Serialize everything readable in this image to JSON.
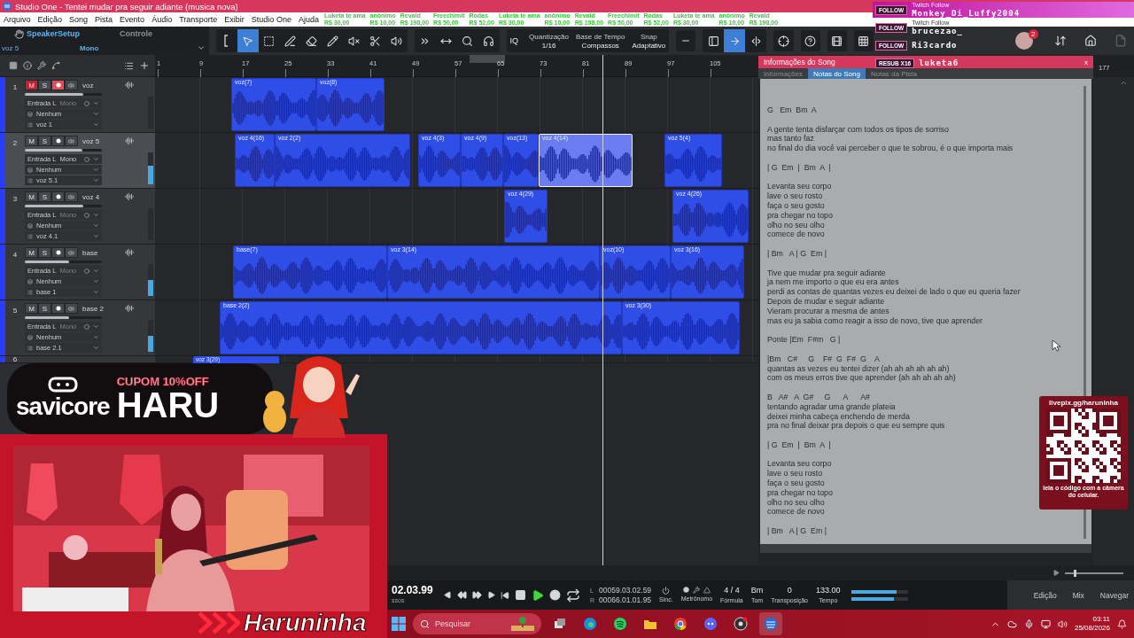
{
  "window": {
    "title": "Studio One - Tentei mudar pra seguir adiante (musica nova)"
  },
  "menu": [
    "Arquivo",
    "Edição",
    "Song",
    "Pista",
    "Evento",
    "Áudio",
    "Transporte",
    "Exibir",
    "Studio One",
    "Ajuda"
  ],
  "ticker": [
    {
      "name": "Luketa te ama",
      "amount": "R$ 30,00"
    },
    {
      "name": "anônimo",
      "amount": "R$ 10,00"
    },
    {
      "name": "Revald",
      "amount": "R$ 198,00"
    },
    {
      "name": "Freechimit",
      "amount": "R$ 50,00"
    },
    {
      "name": "Rodas",
      "amount": "R$ 52,00"
    },
    {
      "name": "Luketa te ama",
      "amount": "R$ 30,00"
    },
    {
      "name": "anônimo",
      "amount": "R$ 10,00"
    },
    {
      "name": "Revald",
      "amount": "R$ 198,00"
    },
    {
      "name": "Freechimit",
      "amount": "R$ 50,00"
    },
    {
      "name": "Rodas",
      "amount": "R$ 52,00"
    },
    {
      "name": "Luketa te ama",
      "amount": "R$ 30,00"
    },
    {
      "name": "anônimo",
      "amount": "R$ 10,00"
    },
    {
      "name": "Revald",
      "amount": "R$ 198,00"
    }
  ],
  "toolbar": {
    "track_name": "voz 5",
    "device": "SpeakerSetup",
    "channel_mode": "Mono",
    "panel_label": "Controle",
    "tools": [
      {
        "kind": "bracket",
        "selected": false
      },
      {
        "kind": "arrow",
        "selected": true
      },
      {
        "kind": "range",
        "selected": false
      },
      {
        "kind": "pen",
        "selected": false
      },
      {
        "kind": "eraser",
        "selected": false
      },
      {
        "kind": "pencil",
        "selected": false
      },
      {
        "kind": "mute",
        "selected": false
      },
      {
        "kind": "split",
        "selected": false
      },
      {
        "kind": "listen",
        "selected": false
      }
    ],
    "edit_tools": [
      {
        "kind": "forward",
        "selected": false
      },
      {
        "kind": "stretch",
        "selected": false
      },
      {
        "kind": "quantize",
        "selected": false
      },
      {
        "kind": "headphones",
        "selected": false
      }
    ],
    "iq": "IQ",
    "quantize": {
      "label": "Quantização",
      "value": "1/16"
    },
    "timebase": {
      "label": "Base de Tempo",
      "value": "Compassos"
    },
    "snap": {
      "label": "Snap",
      "value": "Adaptativo"
    },
    "view_buttons": [
      {
        "kind": "panel",
        "selected": false
      },
      {
        "kind": "follow",
        "selected": true
      },
      {
        "kind": "divider",
        "selected": false
      }
    ],
    "notifications": "2"
  },
  "alerts": [
    {
      "badge": "FOLLOW",
      "source": "Twitch Follow",
      "name": "Monkey_Di_Luffy2004",
      "highlighted": true
    },
    {
      "badge": "FOLLOW",
      "source": "Twitch Follow",
      "name": "brucezao_",
      "highlighted": false
    },
    {
      "badge": "FOLLOW",
      "name": "Ri3cardo",
      "highlighted": false
    },
    {
      "badge": "RESUB X16",
      "name": "luketa6",
      "highlighted": false
    }
  ],
  "ruler": [
    "1",
    "9",
    "17",
    "25",
    "33",
    "41",
    "49",
    "57",
    "65",
    "73",
    "81",
    "89",
    "97",
    "105"
  ],
  "ruler_far": "177",
  "tracks": [
    {
      "kind": "full",
      "number": "1",
      "name": "voz",
      "mute_label": "M",
      "solo_label": "S",
      "muted": true,
      "solo": false,
      "armed": true,
      "selected": false,
      "fader": {
        "level": 0.76
      },
      "input": "Entrada L",
      "mode": "Mono",
      "send": "Nenhum",
      "output": "voz 1",
      "clips": [
        {
          "label": "voz(7)",
          "selected": false
        },
        {
          "label": "voz(8)",
          "selected": false
        }
      ]
    },
    {
      "kind": "full",
      "number": "2",
      "name": "voz 5",
      "mute_label": "M",
      "solo_label": "S",
      "muted": false,
      "solo": false,
      "armed": false,
      "selected": true,
      "fader": {
        "level": 0.75
      },
      "meter": {
        "level": 0.58
      },
      "input": "Entrada L",
      "mode": "Mono",
      "send": "Nenhum",
      "output": "voz 5.1",
      "clips": [
        {
          "label": "voz 4(16)",
          "selected": false
        },
        {
          "label": "voz 2(2)",
          "selected": false
        },
        {
          "label": "voz 4(3)",
          "selected": false
        },
        {
          "label": "voz 4(9)",
          "selected": false
        },
        {
          "label": "voz(13)",
          "selected": false
        },
        {
          "label": "voz 4(14)",
          "selected": true
        },
        {
          "label": "voz 5(4)",
          "selected": false
        }
      ]
    },
    {
      "kind": "full",
      "number": "3",
      "name": "voz 4",
      "mute_label": "M",
      "solo_label": "S",
      "muted": false,
      "solo": false,
      "armed": false,
      "selected": false,
      "fader": {
        "level": 0.76
      },
      "input": "Entrada L",
      "mode": "Mono",
      "send": "Nenhum",
      "output": "voz 4.1",
      "clips": [
        {
          "label": "voz 4(29)",
          "selected": false
        },
        {
          "label": "voz 4(26)",
          "selected": false
        }
      ]
    },
    {
      "kind": "full",
      "number": "4",
      "name": "base",
      "mute_label": "M",
      "solo_label": "S",
      "muted": false,
      "solo": false,
      "armed": false,
      "selected": false,
      "fader": {
        "level": 0.58
      },
      "meter": {
        "level": 0.5
      },
      "input": "Entrada L",
      "mode": "Mono",
      "send": "Nenhum",
      "output": "base 1",
      "clips": [
        {
          "label": "base(7)",
          "selected": false
        },
        {
          "label": "voz 3(14)",
          "selected": false
        },
        {
          "label": "voz(10)",
          "selected": false
        },
        {
          "label": "voz 3(16)",
          "selected": false
        }
      ]
    },
    {
      "kind": "full",
      "number": "5",
      "name": "base 2",
      "mute_label": "M",
      "solo_label": "S",
      "muted": false,
      "solo": false,
      "armed": false,
      "selected": false,
      "fader": {
        "level": 0.58
      },
      "meter": {
        "level": 0.5
      },
      "input": "Entrada L",
      "mode": "Mono",
      "send": "Nenhum",
      "output": "base 2.1",
      "clips": [
        {
          "label": "base 2(2)",
          "selected": false
        },
        {
          "label": "voz 3(30)",
          "selected": false
        }
      ]
    },
    {
      "kind": "partial",
      "number": "6",
      "clips": [
        {
          "label": "voz 3(29)",
          "selected": false
        }
      ]
    }
  ],
  "song_info": {
    "title": "Informações do Song",
    "close": "x",
    "tabs": [
      {
        "label": "Informações",
        "selected": false
      },
      {
        "label": "Notas do Song",
        "selected": true
      },
      {
        "label": "Notas da Pista",
        "selected": false
      }
    ],
    "notes": [
      [
        "G   Em  Bm  A"
      ],
      [
        "A gente tenta disfarçar com todos os tipos de sorriso",
        "mas tanto faz",
        "no final do dia você vai perceber o que te sobrou, é o que importa mais"
      ],
      [
        "| G  Em  |  Bm  A  |"
      ],
      [
        "Levanta seu corpo",
        "lave o seu rosto",
        "faça o seu gosto",
        "pra chegar no topo",
        "olho no seu olho",
        "comece de novo"
      ],
      [
        "| Bm   A | G  Em |"
      ],
      [
        "Tive que mudar pra seguir adiante",
        "ja nem me importo o que eu era antes",
        "perdi as contas de quantas vezes eu deixei de lado o que eu queria fazer",
        "Depois de mudar e seguir adiante",
        "Vieram procurar a mesma de antes",
        "mas eu ja sabia como reagir a isso de novo, tive que aprender"
      ],
      [
        "Ponte |Em  F#m   G |"
      ],
      [
        "|Bm   C#     G    F#  G  F#  G    A",
        "quantas as vezes eu tentei dizer (ah ah ah ah ah ah)",
        "com os meus erros tive que aprender (ah ah ah ah ah)"
      ],
      [
        "B   A#   A  G#     G      A      A#",
        "tentando agradar uma grande plateia",
        "deixei minha cabeça enchendo de merda",
        "pra no final deixar pra depois o que eu sempre quis"
      ],
      [
        "| G  Em  |  Bm  A  |"
      ],
      [
        "Levanta seu corpo",
        "lave o seu rosto",
        "faça o seu gosto",
        "pra chegar no topo",
        "olho no seu olho",
        "comece de novo"
      ],
      [
        "| Bm   A | G  Em |"
      ]
    ]
  },
  "qr": {
    "url": "livepix.gg/haruninha",
    "caption": "leia o código com a câmera do celular."
  },
  "zoom": {
    "level": 0.15
  },
  "transport": {
    "time": "02.03.99",
    "time_unit": "ssos",
    "left_marker": "L",
    "right_marker": "R",
    "loop_start": "00059.03.02.59",
    "loop_end": "00066.01.01.95",
    "sync": "Sinc.",
    "metronome": "Metrônomo",
    "fields": [
      {
        "value": "4 / 4",
        "label": "Fórmula"
      },
      {
        "value": "Bm",
        "label": "Tom"
      },
      {
        "value": "0",
        "label": "Transposição"
      },
      {
        "value": "133.00",
        "label": "Tempo"
      }
    ],
    "meters": [
      {
        "level": 0.8
      },
      {
        "level": 0.75
      }
    ],
    "views": [
      "Edição",
      "Mix",
      "Navegar"
    ]
  },
  "overlay": {
    "brand": "savicore",
    "coupon": "CUPOM 10%OFF",
    "code": "HARU",
    "streamer": "Haruninha"
  },
  "taskbar": {
    "search_placeholder": "Pesquisar",
    "time": "03:11",
    "date": "25/08/2026",
    "apps": [
      {
        "kind": "taskview",
        "active": false
      },
      {
        "kind": "browser",
        "active": false
      },
      {
        "kind": "music",
        "active": false
      },
      {
        "kind": "folder",
        "active": false
      },
      {
        "kind": "chrome",
        "active": false
      },
      {
        "kind": "chat",
        "active": false
      },
      {
        "kind": "recorder",
        "active": false
      },
      {
        "kind": "daw",
        "active": true
      }
    ]
  }
}
